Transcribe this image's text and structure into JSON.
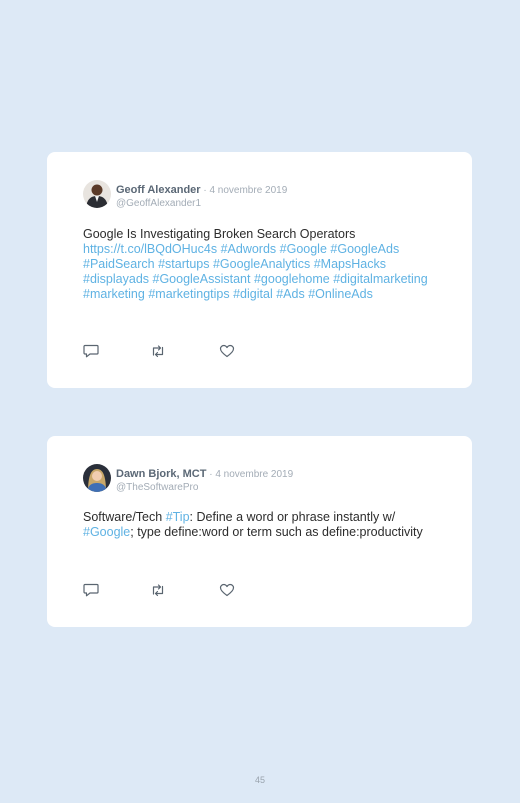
{
  "tweets": [
    {
      "author": "Geoff Alexander",
      "date": " · 4 novembre 2019",
      "handle": "@GeoffAlexander1",
      "text_line": "Google Is Investigating Broken Search Operators",
      "url": "https://t.co/lBQdOHuc4s",
      "hashtags": [
        "#Adwords",
        "#Google",
        "#GoogleAds",
        "#PaidSearch",
        "#startups",
        "#GoogleAnalytics",
        "#MapsHacks",
        "#displayads",
        "#GoogleAssistant",
        "#googlehome",
        "#digitalmarketing",
        "#marketing",
        "#marketingtips",
        "#digital",
        "#Ads",
        "#OnlineAds"
      ]
    },
    {
      "author": "Dawn Bjork, MCT",
      "date": " · 4 novembre 2019",
      "handle": "@TheSoftwarePro",
      "text_pre": "Software/Tech ",
      "tag_tip": "#Tip",
      "text_mid": ": Define a word or phrase instantly w/ ",
      "tag_google": "#Google",
      "text_post": "; type define:word or term such as define:productivity"
    }
  ],
  "page_number": "45",
  "icons": [
    "reply-icon",
    "retweet-icon",
    "like-icon"
  ],
  "colors": {
    "background": "#dde9f6",
    "card": "#ffffff",
    "link": "#5fb2e3",
    "text": "#2c2c2c",
    "muted": "#a3acb6"
  }
}
